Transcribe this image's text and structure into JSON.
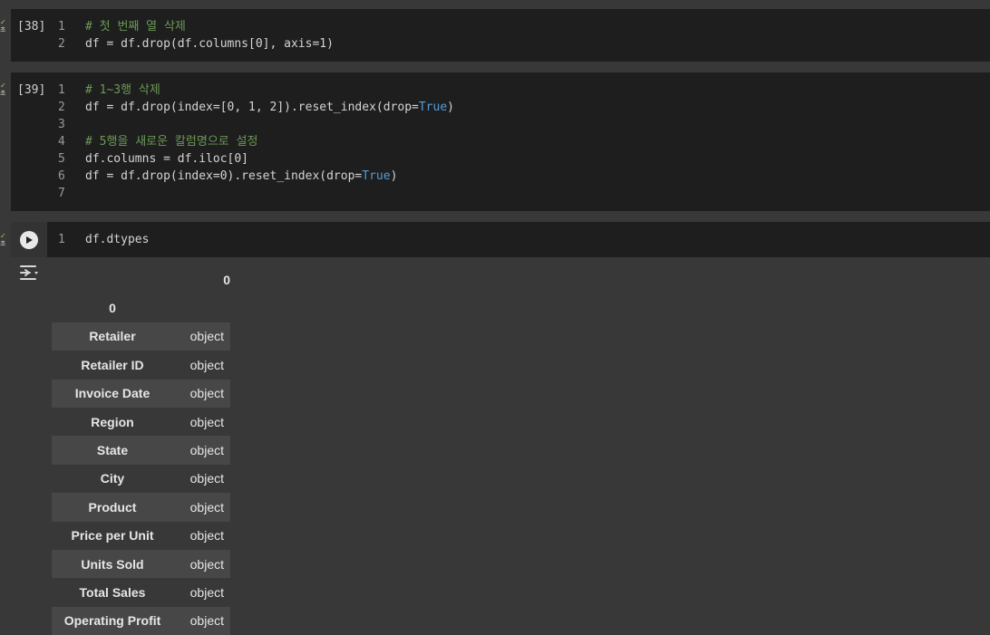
{
  "cells": [
    {
      "exec_count": "[38]",
      "run_status": "✓",
      "run_status_sub": "초",
      "lines": [
        {
          "n": "1",
          "segs": [
            {
              "t": "# 첫 번째 열 삭제",
              "c": "comment"
            }
          ]
        },
        {
          "n": "2",
          "segs": [
            {
              "t": "df = df.drop(df.columns[0], axis=1)",
              "c": ""
            }
          ]
        }
      ]
    },
    {
      "exec_count": "[39]",
      "run_status": "✓",
      "run_status_sub": "초",
      "lines": [
        {
          "n": "1",
          "segs": [
            {
              "t": "# 1~3행 삭제",
              "c": "comment"
            }
          ]
        },
        {
          "n": "2",
          "segs": [
            {
              "t": "df = df.drop(index=[0, 1, 2]).reset_index(drop=",
              "c": ""
            },
            {
              "t": "True",
              "c": "kw"
            },
            {
              "t": ")",
              "c": ""
            }
          ]
        },
        {
          "n": "3",
          "segs": [
            {
              "t": "",
              "c": ""
            }
          ]
        },
        {
          "n": "4",
          "segs": [
            {
              "t": "# 5행을 새로운 칼럼명으로 설정",
              "c": "comment"
            }
          ]
        },
        {
          "n": "5",
          "segs": [
            {
              "t": "df.columns = df.iloc[0]",
              "c": ""
            }
          ]
        },
        {
          "n": "6",
          "segs": [
            {
              "t": "df = df.drop(index=0).reset_index(drop=",
              "c": ""
            },
            {
              "t": "True",
              "c": "kw"
            },
            {
              "t": ")",
              "c": ""
            }
          ]
        },
        {
          "n": "7",
          "segs": [
            {
              "t": "",
              "c": ""
            }
          ]
        }
      ]
    },
    {
      "exec_count": "",
      "run_status": "✓",
      "run_status_sub": "초",
      "lines": [
        {
          "n": "1",
          "segs": [
            {
              "t": "df.dtypes",
              "c": ""
            }
          ]
        }
      ]
    }
  ],
  "output": {
    "column_header": "0",
    "index_name": "0",
    "rows": [
      {
        "index": "Retailer",
        "value": "object"
      },
      {
        "index": "Retailer ID",
        "value": "object"
      },
      {
        "index": "Invoice Date",
        "value": "object"
      },
      {
        "index": "Region",
        "value": "object"
      },
      {
        "index": "State",
        "value": "object"
      },
      {
        "index": "City",
        "value": "object"
      },
      {
        "index": "Product",
        "value": "object"
      },
      {
        "index": "Price per Unit",
        "value": "object"
      },
      {
        "index": "Units Sold",
        "value": "object"
      },
      {
        "index": "Total Sales",
        "value": "object"
      },
      {
        "index": "Operating Profit",
        "value": "object"
      }
    ]
  },
  "icons": {
    "run": "play-icon",
    "output_toggle": "output-actions-icon"
  },
  "colors": {
    "background": "#383838",
    "cell_background": "#1e1e1e",
    "comment": "#6a9955",
    "keyword": "#569cd6",
    "success_check": "#9ccc65"
  }
}
